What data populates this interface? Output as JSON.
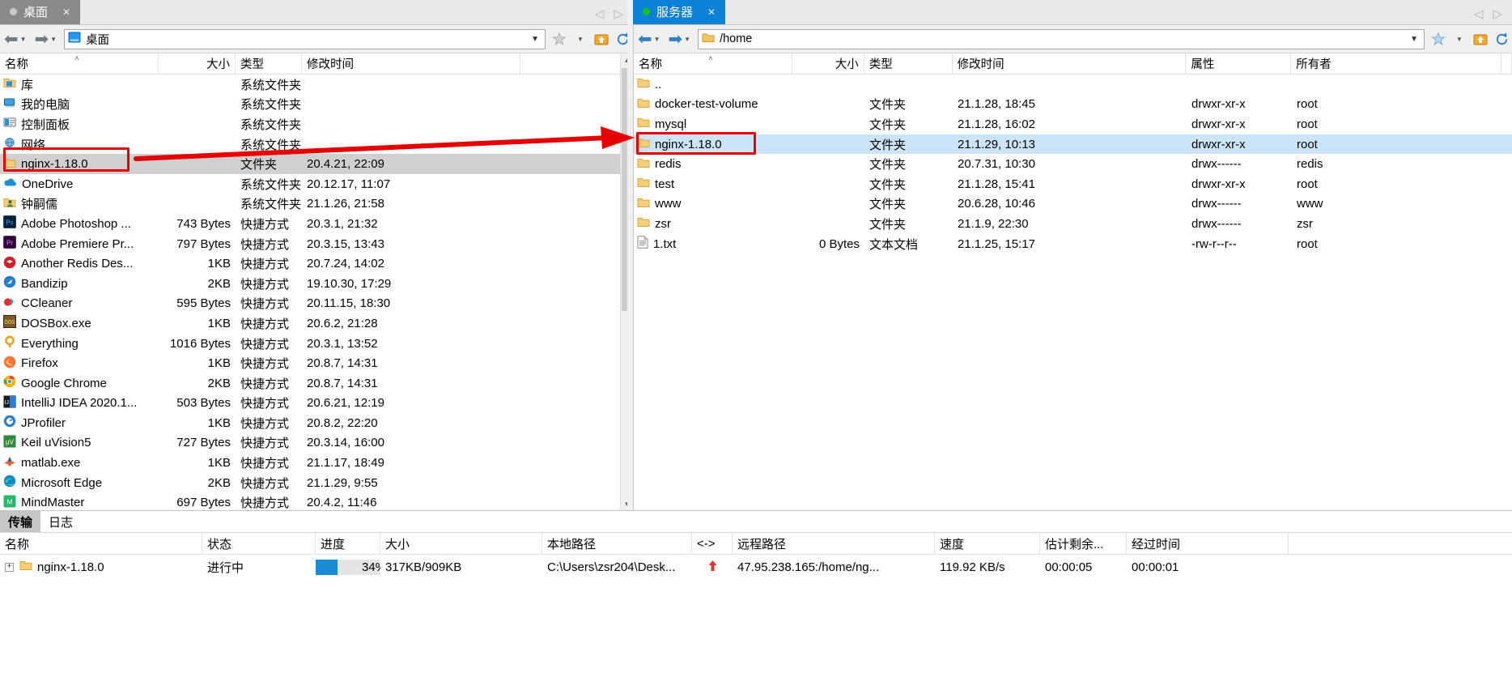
{
  "left_panel": {
    "tab": {
      "label": "桌面",
      "close": "✕",
      "status_dot_color": "#c9c9c9"
    },
    "address": {
      "value": "桌面",
      "icon": "desktop-folder-icon"
    },
    "nav": {
      "back": "back-arrow-icon",
      "forward": "forward-arrow-icon"
    },
    "columns": [
      {
        "label": "名称",
        "align": "left",
        "sorted": true
      },
      {
        "label": "大小",
        "align": "right"
      },
      {
        "label": "类型",
        "align": "left"
      },
      {
        "label": "修改时间",
        "align": "left"
      }
    ],
    "rows": [
      {
        "icon": "library-folder-icon",
        "name": "库",
        "size": "",
        "type": "系统文件夹",
        "modified": ""
      },
      {
        "icon": "computer-icon",
        "name": "我的电脑",
        "size": "",
        "type": "系统文件夹",
        "modified": ""
      },
      {
        "icon": "control-panel-icon",
        "name": "控制面板",
        "size": "",
        "type": "系统文件夹",
        "modified": ""
      },
      {
        "icon": "network-icon",
        "name": "网络",
        "size": "",
        "type": "系统文件夹",
        "modified": ""
      },
      {
        "icon": "folder-icon",
        "name": "nginx-1.18.0",
        "size": "",
        "type": "文件夹",
        "modified": "20.4.21, 22:09",
        "selected": true
      },
      {
        "icon": "onedrive-icon",
        "name": "OneDrive",
        "size": "",
        "type": "系统文件夹",
        "modified": "20.12.17, 11:07"
      },
      {
        "icon": "user-folder-icon",
        "name": "钟嗣儒",
        "size": "",
        "type": "系统文件夹",
        "modified": "21.1.26, 21:58"
      },
      {
        "icon": "photoshop-icon",
        "name": "Adobe Photoshop ...",
        "size": "743 Bytes",
        "type": "快捷方式",
        "modified": "20.3.1, 21:32"
      },
      {
        "icon": "premiere-icon",
        "name": "Adobe Premiere Pr...",
        "size": "797 Bytes",
        "type": "快捷方式",
        "modified": "20.3.15, 13:43"
      },
      {
        "icon": "redis-desktop-icon",
        "name": "Another Redis Des...",
        "size": "1KB",
        "type": "快捷方式",
        "modified": "20.7.24, 14:02"
      },
      {
        "icon": "bandizip-icon",
        "name": "Bandizip",
        "size": "2KB",
        "type": "快捷方式",
        "modified": "19.10.30, 17:29"
      },
      {
        "icon": "ccleaner-icon",
        "name": "CCleaner",
        "size": "595 Bytes",
        "type": "快捷方式",
        "modified": "20.11.15, 18:30"
      },
      {
        "icon": "dosbox-icon",
        "name": "DOSBox.exe",
        "size": "1KB",
        "type": "快捷方式",
        "modified": "20.6.2, 21:28"
      },
      {
        "icon": "everything-icon",
        "name": "Everything",
        "size": "1016 Bytes",
        "type": "快捷方式",
        "modified": "20.3.1, 13:52"
      },
      {
        "icon": "firefox-icon",
        "name": "Firefox",
        "size": "1KB",
        "type": "快捷方式",
        "modified": "20.8.7, 14:31"
      },
      {
        "icon": "chrome-icon",
        "name": "Google Chrome",
        "size": "2KB",
        "type": "快捷方式",
        "modified": "20.8.7, 14:31"
      },
      {
        "icon": "intellij-icon",
        "name": "IntelliJ IDEA 2020.1...",
        "size": "503 Bytes",
        "type": "快捷方式",
        "modified": "20.6.21, 12:19"
      },
      {
        "icon": "jprofiler-icon",
        "name": "JProfiler",
        "size": "1KB",
        "type": "快捷方式",
        "modified": "20.8.2, 22:20"
      },
      {
        "icon": "keil-icon",
        "name": "Keil uVision5",
        "size": "727 Bytes",
        "type": "快捷方式",
        "modified": "20.3.14, 16:00"
      },
      {
        "icon": "matlab-icon",
        "name": "matlab.exe",
        "size": "1KB",
        "type": "快捷方式",
        "modified": "21.1.17, 18:49"
      },
      {
        "icon": "edge-icon",
        "name": "Microsoft Edge",
        "size": "2KB",
        "type": "快捷方式",
        "modified": "21.1.29, 9:55"
      },
      {
        "icon": "mindmaster-icon",
        "name": "MindMaster",
        "size": "697 Bytes",
        "type": "快捷方式",
        "modified": "20.4.2, 11:46"
      }
    ]
  },
  "right_panel": {
    "tab": {
      "label": "服务器",
      "close": "✕",
      "status_dot_color": "#15c415"
    },
    "address": {
      "value": "/home",
      "icon": "remote-folder-icon"
    },
    "columns": [
      {
        "label": "名称",
        "align": "left",
        "sorted": true
      },
      {
        "label": "大小",
        "align": "right"
      },
      {
        "label": "类型",
        "align": "left"
      },
      {
        "label": "修改时间",
        "align": "left"
      },
      {
        "label": "属性",
        "align": "left"
      },
      {
        "label": "所有者",
        "align": "left"
      }
    ],
    "rows": [
      {
        "icon": "folder-icon",
        "name": "..",
        "size": "",
        "type": "",
        "modified": "",
        "perms": "",
        "owner": ""
      },
      {
        "icon": "folder-icon",
        "name": "docker-test-volume",
        "size": "",
        "type": "文件夹",
        "modified": "21.1.28, 18:45",
        "perms": "drwxr-xr-x",
        "owner": "root"
      },
      {
        "icon": "folder-icon",
        "name": "mysql",
        "size": "",
        "type": "文件夹",
        "modified": "21.1.28, 16:02",
        "perms": "drwxr-xr-x",
        "owner": "root"
      },
      {
        "icon": "folder-icon",
        "name": "nginx-1.18.0",
        "size": "",
        "type": "文件夹",
        "modified": "21.1.29, 10:13",
        "perms": "drwxr-xr-x",
        "owner": "root",
        "selected": true
      },
      {
        "icon": "folder-icon",
        "name": "redis",
        "size": "",
        "type": "文件夹",
        "modified": "20.7.31, 10:30",
        "perms": "drwx------",
        "owner": "redis"
      },
      {
        "icon": "folder-icon",
        "name": "test",
        "size": "",
        "type": "文件夹",
        "modified": "21.1.28, 15:41",
        "perms": "drwxr-xr-x",
        "owner": "root"
      },
      {
        "icon": "folder-icon",
        "name": "www",
        "size": "",
        "type": "文件夹",
        "modified": "20.6.28, 10:46",
        "perms": "drwx------",
        "owner": "www"
      },
      {
        "icon": "folder-icon",
        "name": "zsr",
        "size": "",
        "type": "文件夹",
        "modified": "21.1.9, 22:30",
        "perms": "drwx------",
        "owner": "zsr"
      },
      {
        "icon": "text-file-icon",
        "name": "1.txt",
        "size": "0 Bytes",
        "type": "文本文档",
        "modified": "21.1.25, 15:17",
        "perms": "-rw-r--r--",
        "owner": "root"
      }
    ]
  },
  "bottom": {
    "tabs": [
      {
        "label": "传输",
        "active": true
      },
      {
        "label": "日志",
        "active": false
      }
    ],
    "columns": [
      {
        "label": "名称"
      },
      {
        "label": "状态"
      },
      {
        "label": "进度"
      },
      {
        "label": "大小"
      },
      {
        "label": "本地路径"
      },
      {
        "label": "<->"
      },
      {
        "label": "远程路径"
      },
      {
        "label": "速度"
      },
      {
        "label": "估计剩余..."
      },
      {
        "label": "经过时间"
      }
    ],
    "rows": [
      {
        "expander": "+",
        "icon": "folder-icon",
        "name": "nginx-1.18.0",
        "status": "进行中",
        "progress_percent": 34,
        "progress_label": "34%",
        "size": "317KB/909KB",
        "local_path": "C:\\Users\\zsr204\\Desk...",
        "direction_icon": "upload-arrow-icon",
        "remote_path": "47.95.238.165:/home/ng...",
        "speed": "119.92 KB/s",
        "eta": "00:00:05",
        "elapsed": "00:00:01"
      }
    ]
  },
  "annotations": {
    "accent_color": "#e60000",
    "left_box": "highlight-box-local-nginx",
    "right_box": "highlight-box-remote-nginx",
    "arrow": "red-arrow-local-to-remote"
  }
}
